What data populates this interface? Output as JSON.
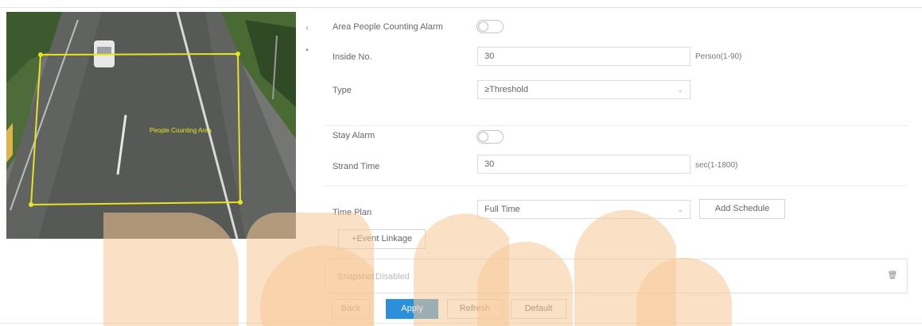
{
  "form": {
    "area_people_counting_alarm": {
      "label": "Area People Counting Alarm",
      "enabled": false
    },
    "inside_no": {
      "label": "Inside No.",
      "value": "30",
      "hint": "Person(1-90)"
    },
    "type": {
      "label": "Type",
      "value": "≥Threshold"
    },
    "stay_alarm": {
      "label": "Stay Alarm",
      "enabled": false
    },
    "stay_time": {
      "label": "Strand Time",
      "value": "30",
      "hint": "sec(1-1800)"
    },
    "time_plan": {
      "label": "Time Plan",
      "value": "Full Time",
      "add_schedule": "Add Schedule"
    },
    "event_linkage_button": "+Event Linkage",
    "snapshot": {
      "label": "Snapshot",
      "status": "Disabled"
    }
  },
  "buttons": {
    "back": "Back",
    "apply": "Apply",
    "refresh": "Refresh",
    "default": "Default"
  },
  "preview": {
    "region_label": "People Counting Area"
  },
  "colors": {
    "accent": "#2b8fd9",
    "region": "#e8e41e",
    "watermark": "#f5c995"
  },
  "icons": {
    "side_collapse": "chevron-left-icon",
    "side_other": "menu-icon",
    "snapshot_delete": "trash-icon"
  }
}
